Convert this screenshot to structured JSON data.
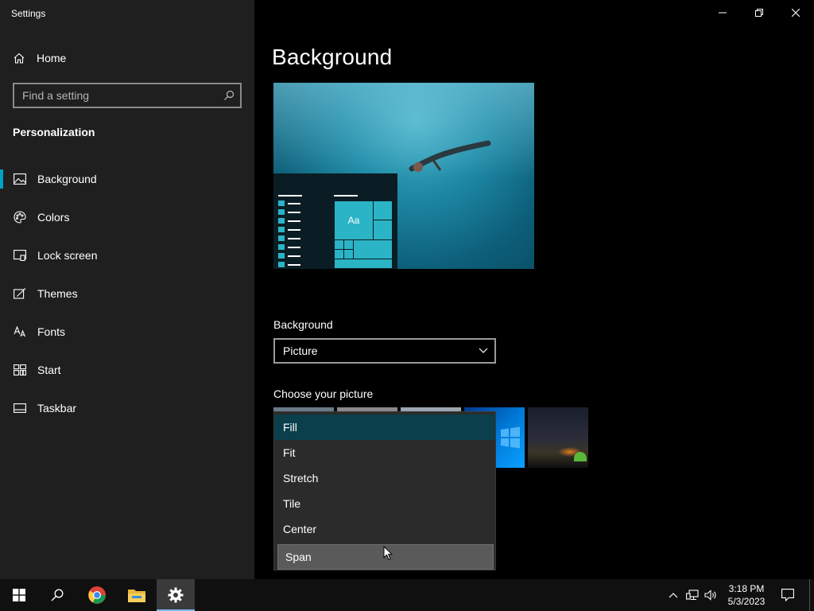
{
  "window": {
    "title": "Settings"
  },
  "sidebar": {
    "home_label": "Home",
    "search_placeholder": "Find a setting",
    "section_title": "Personalization",
    "items": [
      {
        "label": "Background",
        "icon": "picture-icon",
        "active": true
      },
      {
        "label": "Colors",
        "icon": "palette-icon"
      },
      {
        "label": "Lock screen",
        "icon": "lock-screen-icon"
      },
      {
        "label": "Themes",
        "icon": "brush-icon"
      },
      {
        "label": "Fonts",
        "icon": "font-icon"
      },
      {
        "label": "Start",
        "icon": "start-icon"
      },
      {
        "label": "Taskbar",
        "icon": "taskbar-icon"
      }
    ]
  },
  "main": {
    "title": "Background",
    "preview_tile_text": "Aa",
    "background_label": "Background",
    "background_value": "Picture",
    "choose_label": "Choose your picture",
    "fit_options": [
      {
        "label": "Fill",
        "state": "selected"
      },
      {
        "label": "Fit"
      },
      {
        "label": "Stretch"
      },
      {
        "label": "Tile"
      },
      {
        "label": "Center"
      },
      {
        "label": "Span",
        "state": "hover"
      }
    ]
  },
  "taskbar": {
    "time": "3:18 PM",
    "date": "5/3/2023",
    "apps": [
      "start-icon",
      "search-icon",
      "chrome-icon",
      "file-explorer-icon",
      "settings-icon"
    ],
    "active_app": "settings-icon"
  },
  "colors": {
    "accent": "#00a2c4",
    "sidebar_bg": "#1f1f1f",
    "content_bg": "#000000",
    "dropdown_bg": "#2b2b2b",
    "dropdown_selected": "#0b3f4b"
  }
}
